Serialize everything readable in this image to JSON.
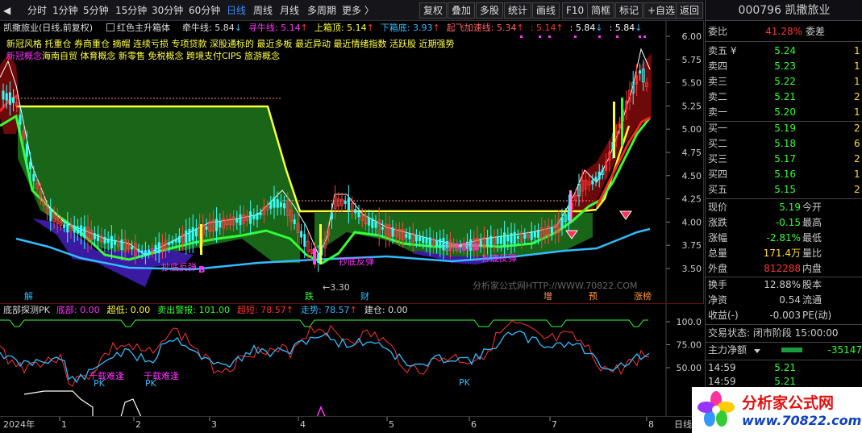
{
  "toolbar": {
    "left": [
      "分时",
      "1分钟",
      "5分钟",
      "15分钟",
      "30分钟",
      "60分钟",
      "日线",
      "周线",
      "月线",
      "多周期",
      "更多 〉"
    ],
    "active": "日线",
    "right": [
      "复权",
      "叠加",
      "多股",
      "统计",
      "画线",
      "F10",
      "简框",
      "标记",
      "+自选",
      "返回"
    ]
  },
  "main": {
    "stock_label": "凯撒旅业(日线,前复权)",
    "checkbox_label": "红色主升箱体",
    "indicators": [
      {
        "name": "牵牛线:",
        "value": "5.84",
        "arrow": "↓",
        "color": "#dddddd"
      },
      {
        "name": "寻牛线:",
        "value": "5.14",
        "arrow": "↑",
        "color": "#ff33ff"
      },
      {
        "name": "上箱顶:",
        "value": "5.14",
        "arrow": "↑",
        "color": "#ffff33"
      },
      {
        "name": "下箱底:",
        "value": "3.93",
        "arrow": "↑",
        "color": "#33bbff"
      },
      {
        "name": "起飞加速线:",
        "value": "5.34",
        "arrow": "↑",
        "color": "#ff6666"
      },
      {
        "name": ":",
        "value": "5.14",
        "arrow": "↑",
        "color": "#ff3333"
      },
      {
        "name": ":",
        "value": "5.84",
        "arrow": "↓",
        "color": "#ffffff"
      },
      {
        "name": ":",
        "value": "5.84",
        "arrow": "↓",
        "color": "#ffffff"
      }
    ],
    "concepts_line1": "新冠风格 托重仓 券商重仓 摘帽 连续亏损 专项贷款 深股通标的 最近多板 最近异动 最近情绪指数 活跃股 近期强势",
    "concepts_line2_a": "新冠概念",
    "concepts_line2_b": "海南自贸 体育概念 新零售 免税概念 跨境支付CIPS 旅游概念",
    "y_ticks": [
      "6.00",
      "5.75",
      "5.50",
      "5.25",
      "5.00",
      "4.75",
      "4.50",
      "4.25",
      "4.00",
      "3.75",
      "3.50"
    ],
    "annotations": {
      "chaodi1": "抄底反弹",
      "chaodi2": "抄底反弹",
      "chaodi3": "抄底反弹",
      "chaodi4": "抄底反弹",
      "low_price": "3.30",
      "b_mark": "B",
      "watermark": "分析家公式网HTTP://WWW.70822.COM"
    },
    "events": [
      {
        "label": "解",
        "color": "#33bbff"
      },
      {
        "label": "跌",
        "color": "#33ff33"
      },
      {
        "label": "财",
        "color": "#33bbff"
      },
      {
        "label": "增",
        "color": "#ff9966"
      },
      {
        "label": "预",
        "color": "#ff9933"
      },
      {
        "label": "涨榜",
        "color": "#ff9933"
      }
    ]
  },
  "lower": {
    "title": "底部探测PK",
    "items": [
      {
        "name": "底部:",
        "value": "0.00",
        "color": "#ff33ff"
      },
      {
        "name": "超低:",
        "value": "0.00",
        "color": "#ffff33"
      },
      {
        "name": "卖出警报:",
        "value": "101.00",
        "color": "#33ff33"
      },
      {
        "name": "超短:",
        "value": "78.57",
        "arrow": "↑",
        "color": "#ff3333"
      },
      {
        "name": "走势:",
        "value": "78.57",
        "arrow": "↑",
        "color": "#33bbff"
      },
      {
        "name": "建仓:",
        "value": "0.00",
        "color": "#dddddd"
      }
    ],
    "y_ticks": [
      "100.0",
      "75.00",
      "50.00"
    ],
    "tags": {
      "buy1": "千载难逢",
      "buy2": "千载难逢",
      "pk1": "PK",
      "pk2": "PK",
      "pk3": "PK"
    }
  },
  "xaxis": {
    "labels": [
      "2024年",
      "1",
      "2",
      "3",
      "4",
      "5",
      "6",
      "7",
      "8"
    ],
    "right_label": "日线"
  },
  "right_panel": {
    "code_name": "000796 凯撒旅业",
    "weibi": {
      "label": "委比",
      "value": "41.28%",
      "label2": "委差"
    },
    "asks": [
      {
        "label": "卖五 ¥",
        "price": "5.24",
        "vol": "1"
      },
      {
        "label": "卖四",
        "price": "5.23",
        "vol": "1"
      },
      {
        "label": "卖三",
        "price": "5.22",
        "vol": "1"
      },
      {
        "label": "卖二",
        "price": "5.21",
        "vol": "2"
      },
      {
        "label": "卖一",
        "price": "5.20",
        "vol": "1"
      }
    ],
    "bids": [
      {
        "label": "买一",
        "price": "5.19",
        "vol": "2"
      },
      {
        "label": "买二",
        "price": "5.18",
        "vol": "6"
      },
      {
        "label": "买三",
        "price": "5.17",
        "vol": "2"
      },
      {
        "label": "买四",
        "price": "5.16",
        "vol": "1"
      },
      {
        "label": "买五",
        "price": "5.15",
        "vol": "2"
      }
    ],
    "quote": [
      {
        "l1": "现价",
        "v1": "5.19",
        "l2": "今开",
        "c1": "#33ff33"
      },
      {
        "l1": "涨跌",
        "v1": "-0.15",
        "l2": "最高",
        "c1": "#33ff33"
      },
      {
        "l1": "涨幅",
        "v1": "-2.81%",
        "l2": "最低",
        "c1": "#33ff33"
      },
      {
        "l1": "总量",
        "v1": "171.4万",
        "l2": "量比",
        "c1": "#ffdd33"
      },
      {
        "l1": "外盘",
        "v1": "812288",
        "l2": "内盘",
        "c1": "#ff3333"
      }
    ],
    "stats": [
      {
        "l1": "换手",
        "v1": "12.88%",
        "l2": "股本"
      },
      {
        "l1": "净资",
        "v1": "0.54",
        "l2": "流通"
      },
      {
        "l1": "收益(-)",
        "v1": "-0.003",
        "l2": "PE(动)"
      }
    ],
    "status": "交易状态: 闭市阶段 15:00:00",
    "flow": {
      "label": "主力净额",
      "value": "-35147"
    },
    "ticks": [
      {
        "time": "14:59",
        "price": "5.21"
      },
      {
        "time": "14:59",
        "price": "5.21"
      }
    ]
  },
  "logo": {
    "text": "分析家公式网",
    "url": "www.70822.com"
  }
}
